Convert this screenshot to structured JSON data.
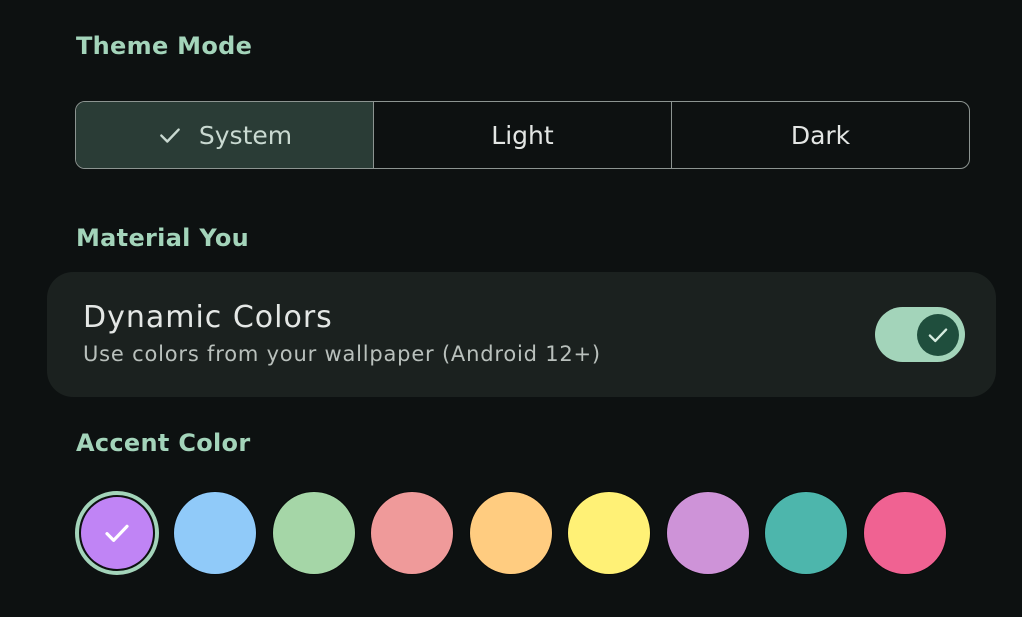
{
  "theme_mode": {
    "title": "Theme Mode",
    "options": [
      {
        "label": "System",
        "selected": true
      },
      {
        "label": "Light",
        "selected": false
      },
      {
        "label": "Dark",
        "selected": false
      }
    ]
  },
  "material_you": {
    "title": "Material You",
    "dynamic_colors": {
      "title": "Dynamic Colors",
      "subtitle": "Use colors from your wallpaper (Android 12+)",
      "enabled": true
    }
  },
  "accent_color": {
    "title": "Accent Color",
    "swatches": [
      {
        "color": "#c084f5",
        "selected": true
      },
      {
        "color": "#90caf9",
        "selected": false
      },
      {
        "color": "#a5d6a7",
        "selected": false
      },
      {
        "color": "#ef9a9a",
        "selected": false
      },
      {
        "color": "#ffcc80",
        "selected": false
      },
      {
        "color": "#fff176",
        "selected": false
      },
      {
        "color": "#ce93d8",
        "selected": false
      },
      {
        "color": "#4db6ac",
        "selected": false
      },
      {
        "color": "#f06292",
        "selected": false
      }
    ]
  },
  "icons": {
    "selected_check": "check-icon",
    "toggle_check": "check-icon",
    "swatch_check": "check-icon"
  },
  "colors": {
    "accent": "#a3d4ba",
    "background": "#0d1111",
    "card": "#1b211f",
    "segment_selected": "#2a3c36"
  }
}
